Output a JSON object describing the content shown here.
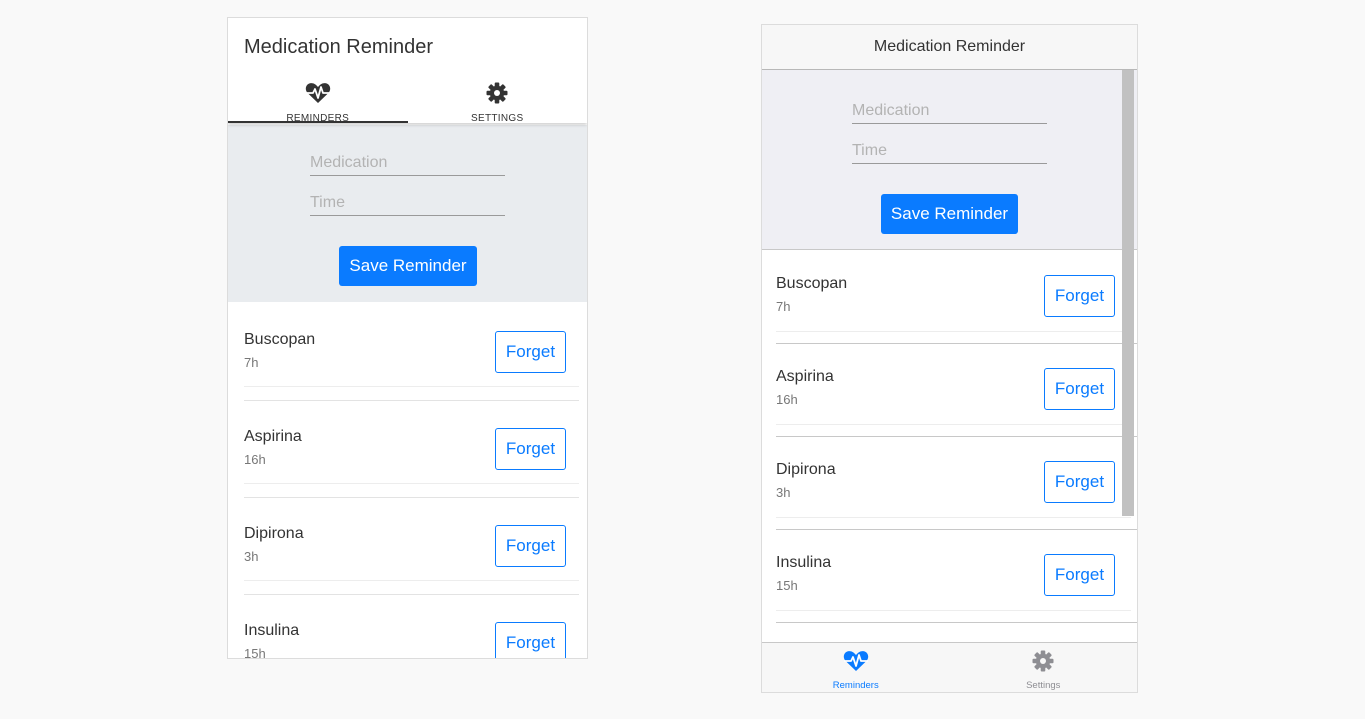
{
  "colors": {
    "primary": "#0a7bff",
    "background": "#f9f9f9",
    "form_bg": "#e9ecef",
    "ios_form_bg": "#efeff4",
    "inactive_icon": "#8e8e93"
  },
  "android": {
    "title": "Medication Reminder",
    "tabs": [
      {
        "label": "REMINDERS",
        "icon": "heartbeat-icon",
        "active": true
      },
      {
        "label": "SETTINGS",
        "icon": "gear-icon",
        "active": false
      }
    ],
    "form": {
      "medication_placeholder": "Medication",
      "time_placeholder": "Time",
      "save_label": "Save Reminder"
    },
    "reminders": [
      {
        "name": "Buscopan",
        "time": "7h",
        "action": "Forget"
      },
      {
        "name": "Aspirina",
        "time": "16h",
        "action": "Forget"
      },
      {
        "name": "Dipirona",
        "time": "3h",
        "action": "Forget"
      },
      {
        "name": "Insulina",
        "time": "15h",
        "action": "Forget"
      }
    ]
  },
  "ios": {
    "title": "Medication Reminder",
    "form": {
      "medication_placeholder": "Medication",
      "time_placeholder": "Time",
      "save_label": "Save Reminder"
    },
    "reminders": [
      {
        "name": "Buscopan",
        "time": "7h",
        "action": "Forget"
      },
      {
        "name": "Aspirina",
        "time": "16h",
        "action": "Forget"
      },
      {
        "name": "Dipirona",
        "time": "3h",
        "action": "Forget"
      },
      {
        "name": "Insulina",
        "time": "15h",
        "action": "Forget"
      }
    ],
    "tabs": [
      {
        "label": "Reminders",
        "icon": "heartbeat-icon",
        "active": true
      },
      {
        "label": "Settings",
        "icon": "gear-icon",
        "active": false
      }
    ]
  }
}
